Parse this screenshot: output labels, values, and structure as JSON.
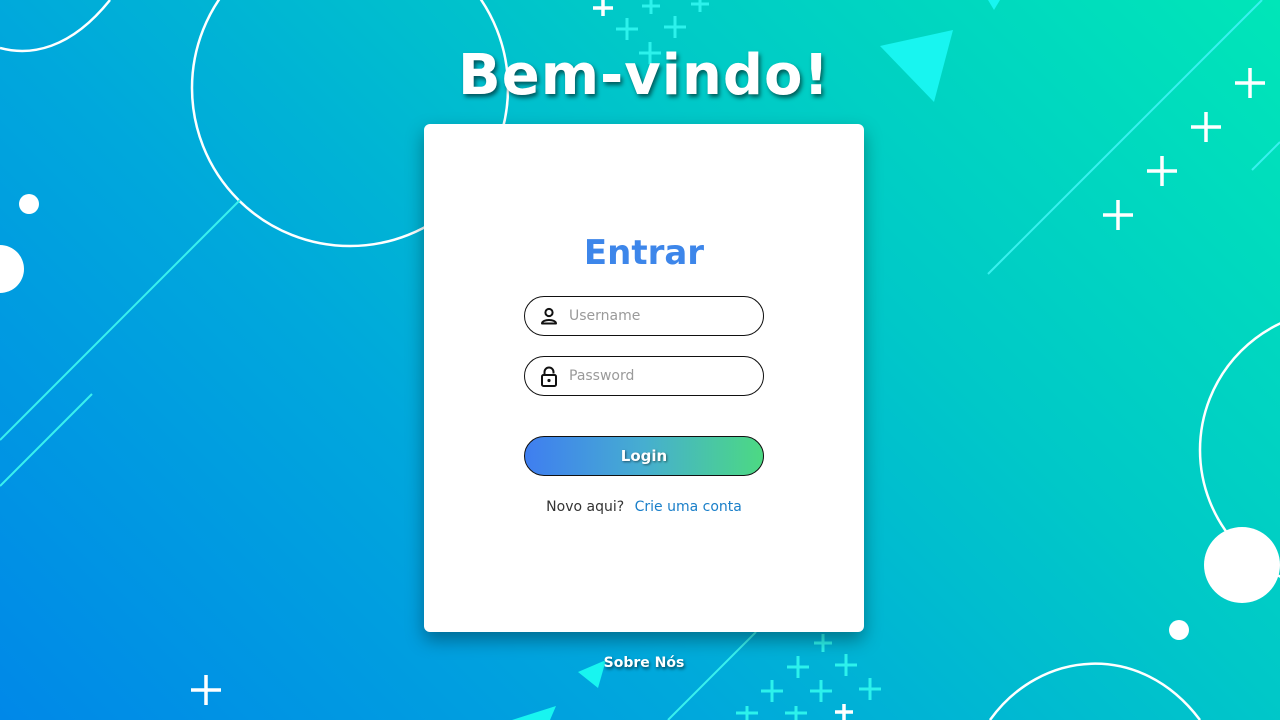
{
  "page": {
    "title": "Bem-vindo!"
  },
  "login_card": {
    "heading": "Entrar",
    "username": {
      "icon": "user-icon",
      "placeholder": "Username",
      "value": ""
    },
    "password": {
      "icon": "lock-icon",
      "placeholder": "Password",
      "value": ""
    },
    "login_button_label": "Login",
    "signup_prompt": "Novo aqui?",
    "signup_link": "Crie uma conta"
  },
  "footer": {
    "about_link": "Sobre Nós"
  },
  "colors": {
    "heading": "#3d86ea",
    "link": "#1a7fc9",
    "button_gradient_start": "#3f7ef0",
    "button_gradient_end": "#4cd983",
    "background_start": "#0088e8",
    "background_end": "#00e6b8"
  }
}
